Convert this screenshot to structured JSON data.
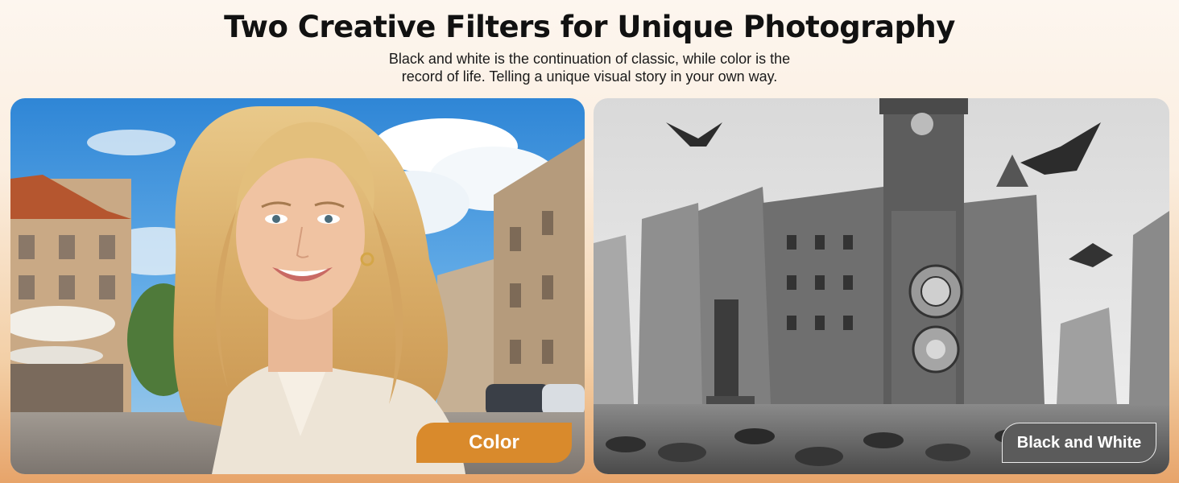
{
  "header": {
    "title": "Two Creative Filters for Unique Photography",
    "subtitle_line1": "Black and white is the continuation of classic, while color is the",
    "subtitle_line2": "record of life. Telling a unique visual story in your own way."
  },
  "panels": [
    {
      "id": "color",
      "label": "Color",
      "accent": "#d98a2c"
    },
    {
      "id": "bw",
      "label": "Black and White",
      "accent": "#5b5b5b"
    }
  ]
}
